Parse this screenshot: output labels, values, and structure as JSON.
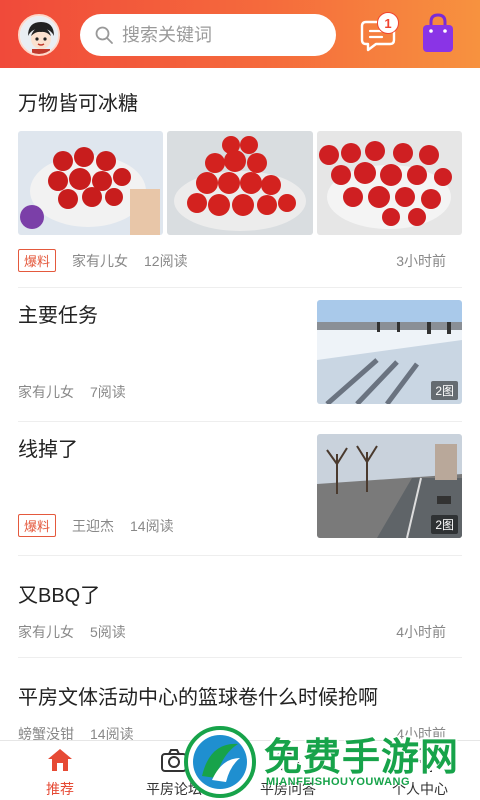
{
  "header": {
    "search_placeholder": "搜索关键词",
    "message_badge": "1"
  },
  "feed": [
    {
      "title": "万物皆可冰糖",
      "tag": "爆料",
      "author": "家有儿女",
      "reads": "12阅读",
      "time": "3小时前"
    },
    {
      "title": "主要任务",
      "author": "家有儿女",
      "reads": "7阅读",
      "photo_count": "2图"
    },
    {
      "title": "线掉了",
      "tag": "爆料",
      "author": "王迎杰",
      "reads": "14阅读",
      "photo_count": "2图"
    },
    {
      "title": "又BBQ了",
      "author": "家有儿女",
      "reads": "5阅读",
      "time": "4小时前"
    },
    {
      "title": "平房文体活动中心的篮球卷什么时候抢啊",
      "author": "螃蟹没钳",
      "reads": "14阅读",
      "time": "4小时前"
    }
  ],
  "nav": [
    {
      "label": "推荐",
      "icon": "home-icon"
    },
    {
      "label": "平房论坛",
      "icon": "camera-icon"
    },
    {
      "label": "平房问答",
      "icon": "question-icon"
    },
    {
      "label": "个人中心",
      "icon": "person-icon"
    }
  ],
  "watermark": {
    "text": "免费手游网",
    "sub": "MIANFEISHOUYOUWANG"
  },
  "colors": {
    "header_start": "#f04a3a",
    "header_end": "#f7923f",
    "accent": "#e64a34",
    "watermark": "#17a34a"
  }
}
